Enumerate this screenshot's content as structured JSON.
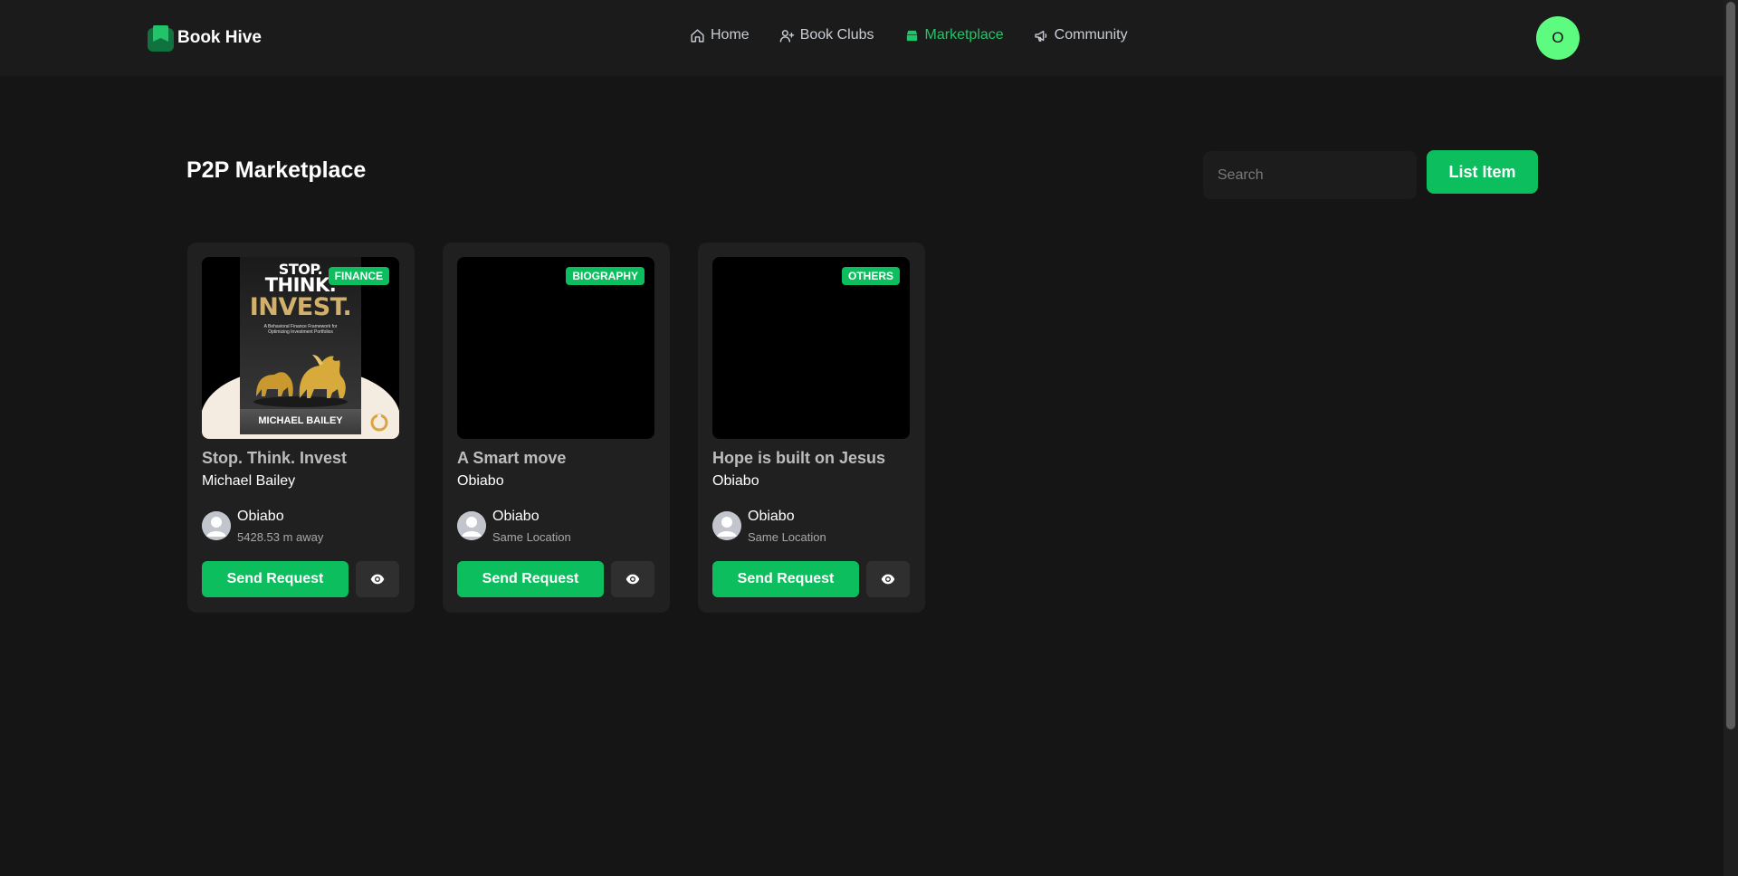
{
  "app": {
    "name": "Book Hive",
    "user_initial": "O"
  },
  "nav": {
    "items": [
      {
        "label": "Home",
        "icon": "home-icon",
        "active": false
      },
      {
        "label": "Book Clubs",
        "icon": "user-plus-icon",
        "active": false
      },
      {
        "label": "Marketplace",
        "icon": "shop-icon",
        "active": true
      },
      {
        "label": "Community",
        "icon": "megaphone-icon",
        "active": false
      }
    ]
  },
  "page": {
    "title": "P2P Marketplace",
    "search_placeholder": "Search",
    "list_item_label": "List Item"
  },
  "cards": [
    {
      "category": "FINANCE",
      "title": "Stop. Think. Invest",
      "author": "Michael Bailey",
      "owner": "Obiabo",
      "distance": "5428.53 m away",
      "send_label": "Send Request",
      "cover": {
        "line1": "STOP.",
        "line2": "THINK.",
        "line3": "INVEST.",
        "subtitle": "A Behavioral Finance Framework for Optimizing Investment Portfolios",
        "author_band": "MICHAEL BAILEY"
      }
    },
    {
      "category": "BIOGRAPHY",
      "title": "A Smart move",
      "author": "Obiabo",
      "owner": "Obiabo",
      "distance": "Same Location",
      "send_label": "Send Request"
    },
    {
      "category": "OTHERS",
      "title": "Hope is built on Jesus",
      "author": "Obiabo",
      "owner": "Obiabo",
      "distance": "Same Location",
      "send_label": "Send Request"
    }
  ],
  "colors": {
    "accent": "#0dbe5f",
    "nav_active": "#22c46a",
    "avatar": "#5dfb7f",
    "background": "#151515",
    "card": "#202020"
  }
}
